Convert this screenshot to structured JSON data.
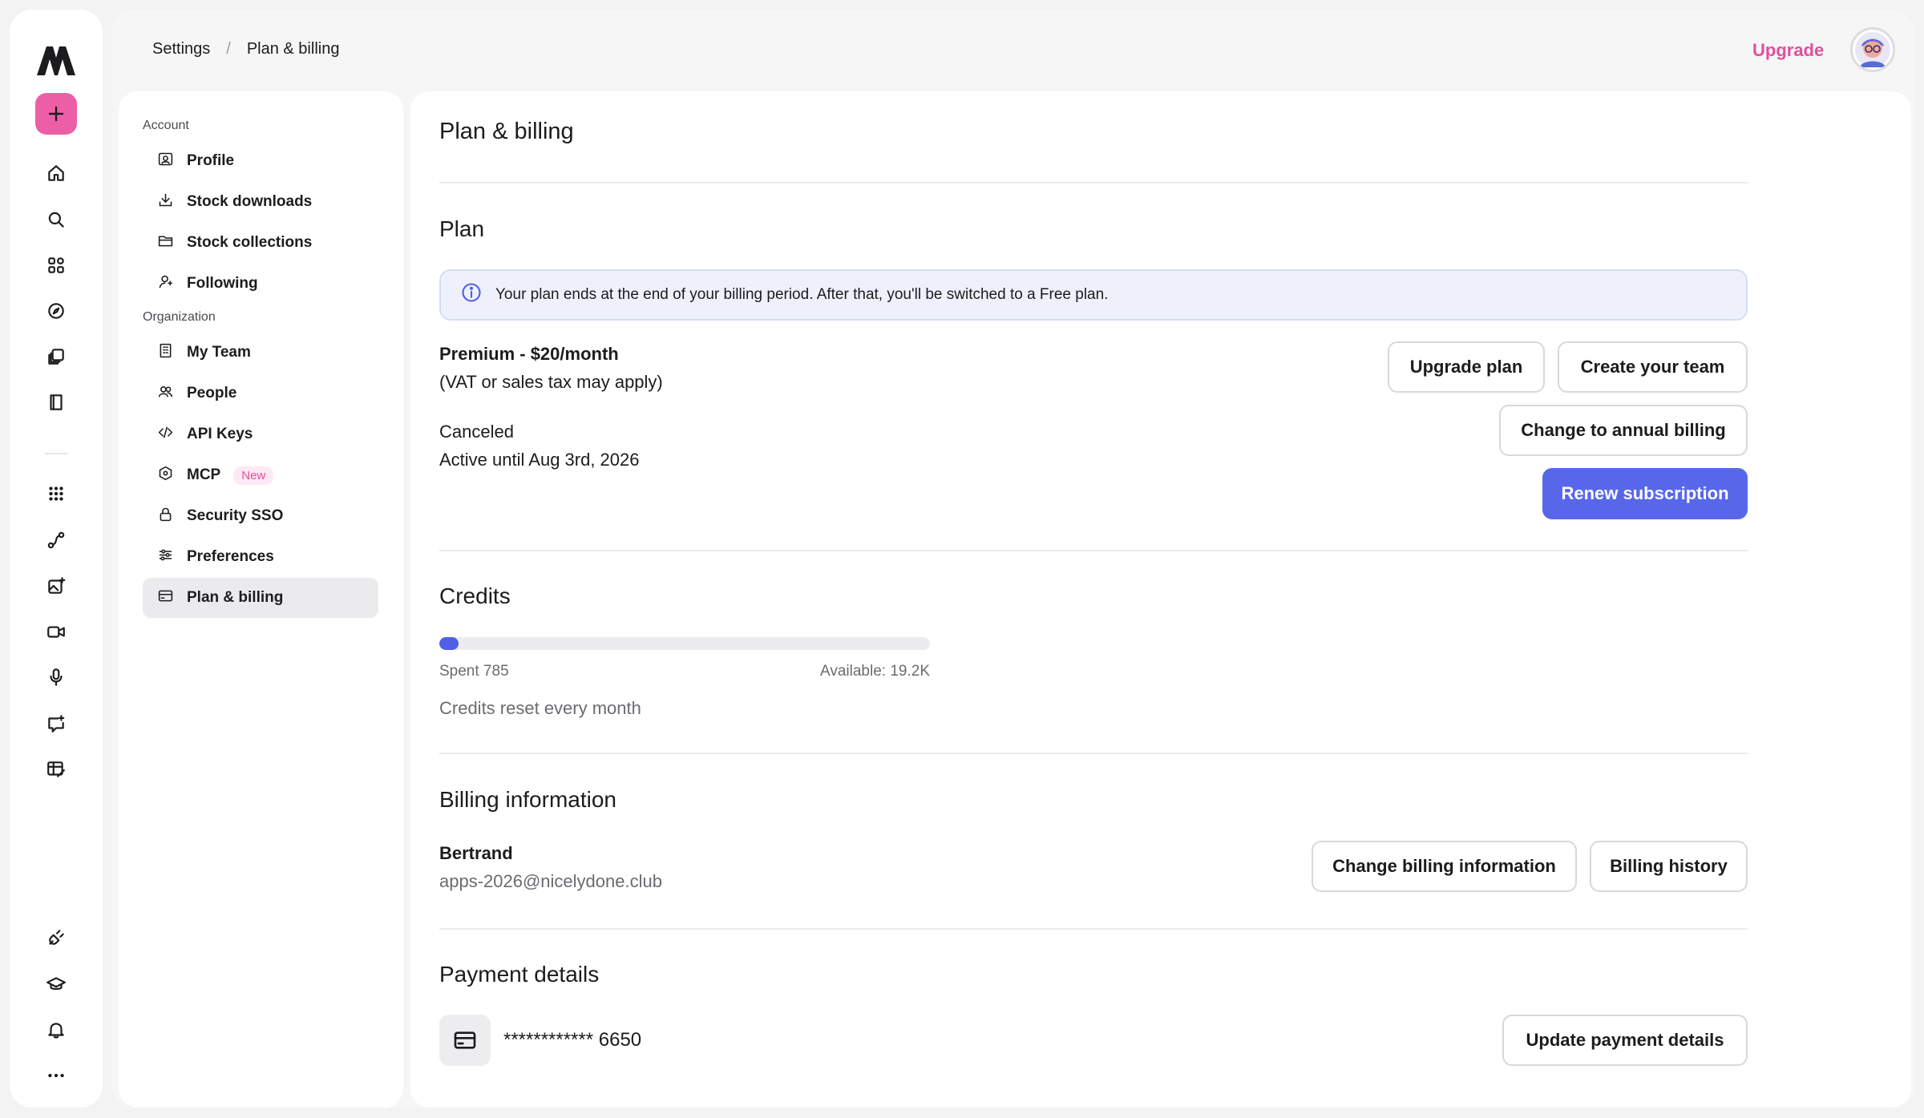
{
  "header": {
    "breadcrumb": [
      "Settings",
      "Plan & billing"
    ],
    "separator": "/",
    "upgrade_label": "Upgrade",
    "accent_color": "#e0509a"
  },
  "rail": {
    "top_icons": [
      "home-icon",
      "search-icon",
      "grid-icon",
      "compass-icon",
      "stack-icon",
      "book-icon"
    ],
    "tool_icons": [
      "apps-icon",
      "workflow-icon",
      "image-sparkle-icon",
      "video-icon",
      "microphone-icon",
      "chat-sparkle-icon",
      "edit-board-icon"
    ],
    "bottom_icons": [
      "plug-icon",
      "graduation-icon",
      "bell-icon",
      "more-icon"
    ]
  },
  "settings_nav": {
    "account_label": "Account",
    "organization_label": "Organization",
    "account_items": [
      {
        "label": "Profile",
        "icon": "profile-icon"
      },
      {
        "label": "Stock downloads",
        "icon": "download-icon"
      },
      {
        "label": "Stock collections",
        "icon": "folder-icon"
      },
      {
        "label": "Following",
        "icon": "person-icon"
      }
    ],
    "organization_items": [
      {
        "label": "My Team",
        "icon": "building-icon"
      },
      {
        "label": "People",
        "icon": "people-icon"
      },
      {
        "label": "API Keys",
        "icon": "code-icon"
      },
      {
        "label": "MCP",
        "icon": "hexagon-icon",
        "badge": "New"
      },
      {
        "label": "Security SSO",
        "icon": "lock-icon"
      },
      {
        "label": "Preferences",
        "icon": "sliders-icon"
      },
      {
        "label": "Plan & billing",
        "icon": "card-icon",
        "active": true
      }
    ]
  },
  "page": {
    "title": "Plan & billing",
    "plan": {
      "heading": "Plan",
      "notice": "Your plan ends at the end of your billing period. After that, you'll be switched to a Free plan.",
      "name": "Premium - $20/month",
      "tax_note": "(VAT or sales tax may apply)",
      "status": "Canceled",
      "active_until": "Active until Aug 3rd, 2026",
      "buttons": {
        "upgrade": "Upgrade plan",
        "create_team": "Create your team",
        "annual": "Change to annual billing",
        "renew": "Renew subscription"
      }
    },
    "credits": {
      "heading": "Credits",
      "spent_label": "Spent 785",
      "available_label": "Available: 19.2K",
      "spent_fraction": 0.039,
      "reset_note": "Credits reset every month"
    },
    "billing": {
      "heading": "Billing information",
      "name": "Bertrand",
      "email": "apps-2026@nicelydone.club",
      "buttons": {
        "change": "Change billing information",
        "history": "Billing history"
      }
    },
    "payment": {
      "heading": "Payment details",
      "card_masked": "************ 6650",
      "update_button": "Update payment details"
    }
  },
  "colors": {
    "primary": "#5867ea",
    "brand_pink": "#ec5fa7"
  }
}
